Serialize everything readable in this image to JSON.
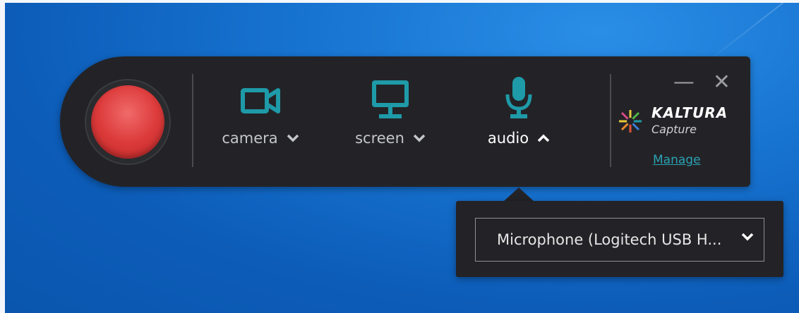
{
  "toolbar": {
    "record_button": "record",
    "sources": [
      {
        "label": "camera",
        "icon": "camera-icon",
        "chevron": "down"
      },
      {
        "label": "screen",
        "icon": "monitor-icon",
        "chevron": "down"
      },
      {
        "label": "audio",
        "icon": "microphone-icon",
        "chevron": "up",
        "active": true
      }
    ],
    "window_controls": {
      "minimize": "—",
      "close": "✕"
    },
    "logo": {
      "brand": "KALTURA",
      "product": "Capture"
    },
    "manage_label": "Manage"
  },
  "audio_popup": {
    "selected_device": "Microphone (Logitech USB H..."
  },
  "colors": {
    "accent": "#1e9aa8",
    "toolbar_bg": "#232327",
    "record": "#dd3b3b",
    "link": "#2aa3b4"
  }
}
